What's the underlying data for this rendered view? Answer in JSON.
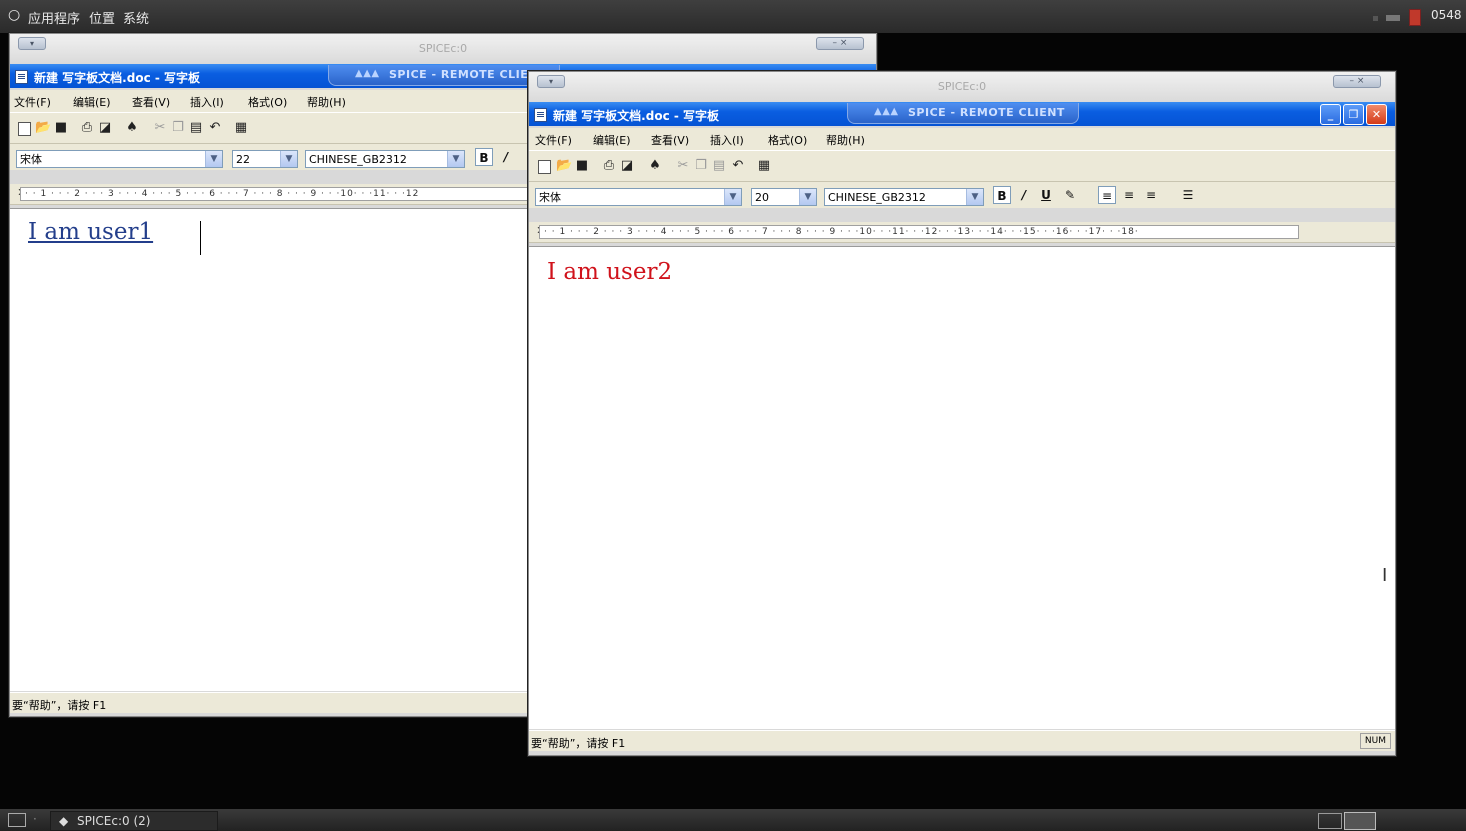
{
  "top_panel": {
    "applications": "应用程序",
    "places": "位置",
    "system": "系统",
    "clock": "0548"
  },
  "window1": {
    "spice_title": "SPICEc:0",
    "wordpad_title": "新建 写字板文档.doc - 写字板",
    "banner": "SPICE - REMOTE CLIE",
    "menu": [
      "文件(F)",
      "编辑(E)",
      "查看(V)",
      "插入(I)",
      "格式(O)",
      "帮助(H)"
    ],
    "font_name": "宋体",
    "font_size": "22",
    "charset": "CHINESE_GB2312",
    "ruler": "· · 1 · · · 2 · · · 3 · · · 4 · · · 5 · · · 6 · · · 7 · · · 8 · · · 9 · · ·10· · ·11· · ·12",
    "document_text": "I am user1",
    "status": "要“帮助”，请按 F1"
  },
  "window2": {
    "spice_title": "SPICEc:0",
    "wordpad_title": "新建 写字板文档.doc - 写字板",
    "banner": "SPICE - REMOTE CLIENT",
    "menu": [
      "文件(F)",
      "编辑(E)",
      "查看(V)",
      "插入(I)",
      "格式(O)",
      "帮助(H)"
    ],
    "font_name": "宋体",
    "font_size": "20",
    "charset": "CHINESE_GB2312",
    "ruler": "· · 1 · · · 2 · · · 3 · · · 4 · · · 5 · · · 6 · · · 7 · · · 8 · · · 9 · · ·10· · ·11· · ·12· · ·13· · ·14· · ·15· · ·16· · ·17· · ·18·",
    "document_text": "I am user2",
    "status": "要“帮助”，请按 F1",
    "num_indicator": "NUM"
  },
  "taskbar": {
    "task_label": "SPICEc:0 (2)"
  },
  "colors": {
    "user1_text": "#233e8b",
    "user2_text": "#d0121b",
    "xp_titlebar": "#0553d4"
  }
}
